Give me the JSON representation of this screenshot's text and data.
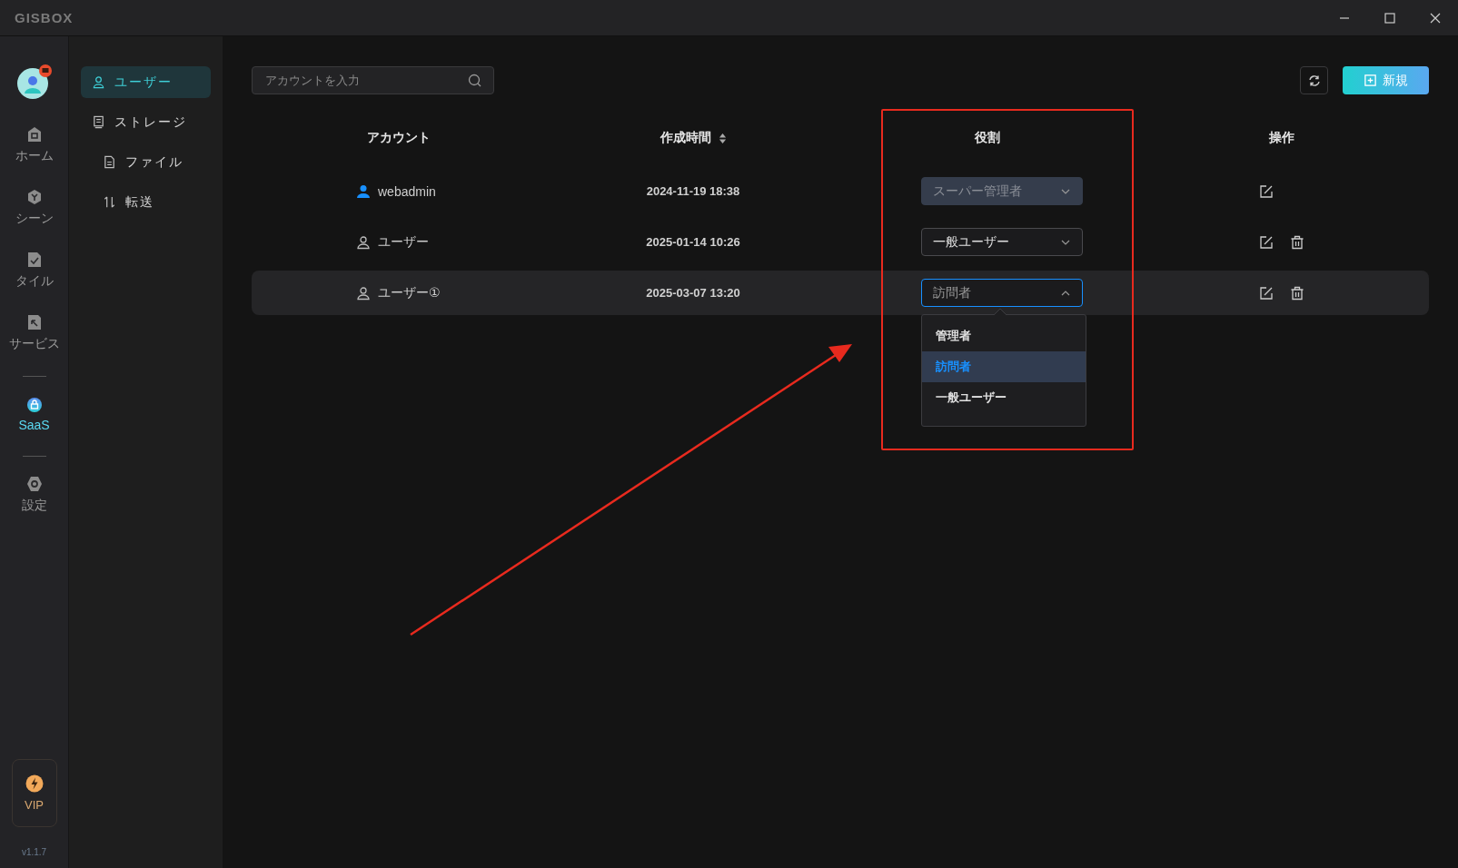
{
  "app": {
    "logo": "GISBOX"
  },
  "rail": {
    "groups": [
      {
        "items": [
          {
            "label": "ホーム",
            "kind": "home",
            "selected": false
          },
          {
            "label": "シーン",
            "kind": "scene",
            "selected": false
          },
          {
            "label": "タイル",
            "kind": "tile",
            "selected": false
          },
          {
            "label": "サービス",
            "kind": "service",
            "selected": false
          }
        ]
      },
      {
        "items": [
          {
            "label": "SaaS",
            "kind": "saas",
            "selected": true
          }
        ]
      },
      {
        "items": [
          {
            "label": "設定",
            "kind": "settings",
            "selected": false
          }
        ]
      }
    ],
    "vip": "VIP",
    "version": "v1.1.7"
  },
  "sidebar": {
    "items": [
      {
        "label": "ユーザー",
        "kind": "user",
        "selected": true
      },
      {
        "label": "ストレージ",
        "kind": "storage",
        "selected": false,
        "children": [
          {
            "label": "ファイル",
            "kind": "file",
            "selected": false
          },
          {
            "label": "転送",
            "kind": "transfer",
            "selected": false
          }
        ]
      }
    ]
  },
  "toolbar": {
    "search": {
      "placeholder": "アカウントを入力"
    },
    "new_button": "新規"
  },
  "table": {
    "columns": [
      {
        "label": "アカウント",
        "sortable": false
      },
      {
        "label": "作成時間",
        "sortable": true
      },
      {
        "label": "役割",
        "sortable": false
      },
      {
        "label": "操作",
        "sortable": false
      }
    ],
    "rows": [
      {
        "account": "webadmin",
        "kind": "admin",
        "time": "2024-11-19 18:38",
        "role": "スーパー管理者",
        "disabled": true,
        "expanded": false,
        "highlighted": false,
        "deletable": false
      },
      {
        "account": "ユーザー",
        "kind": "user",
        "time": "2025-01-14 10:26",
        "role": "一般ユーザー",
        "disabled": false,
        "expanded": false,
        "highlighted": false,
        "deletable": true
      },
      {
        "account": "ユーザー①",
        "kind": "user",
        "time": "2025-03-07 13:20",
        "role": "訪問者",
        "disabled": false,
        "expanded": true,
        "highlighted": true,
        "deletable": true,
        "options": [
          {
            "label": "管理者",
            "selected": false
          },
          {
            "label": "訪問者",
            "selected": true
          },
          {
            "label": "一般ユーザー",
            "selected": false
          }
        ]
      }
    ]
  }
}
